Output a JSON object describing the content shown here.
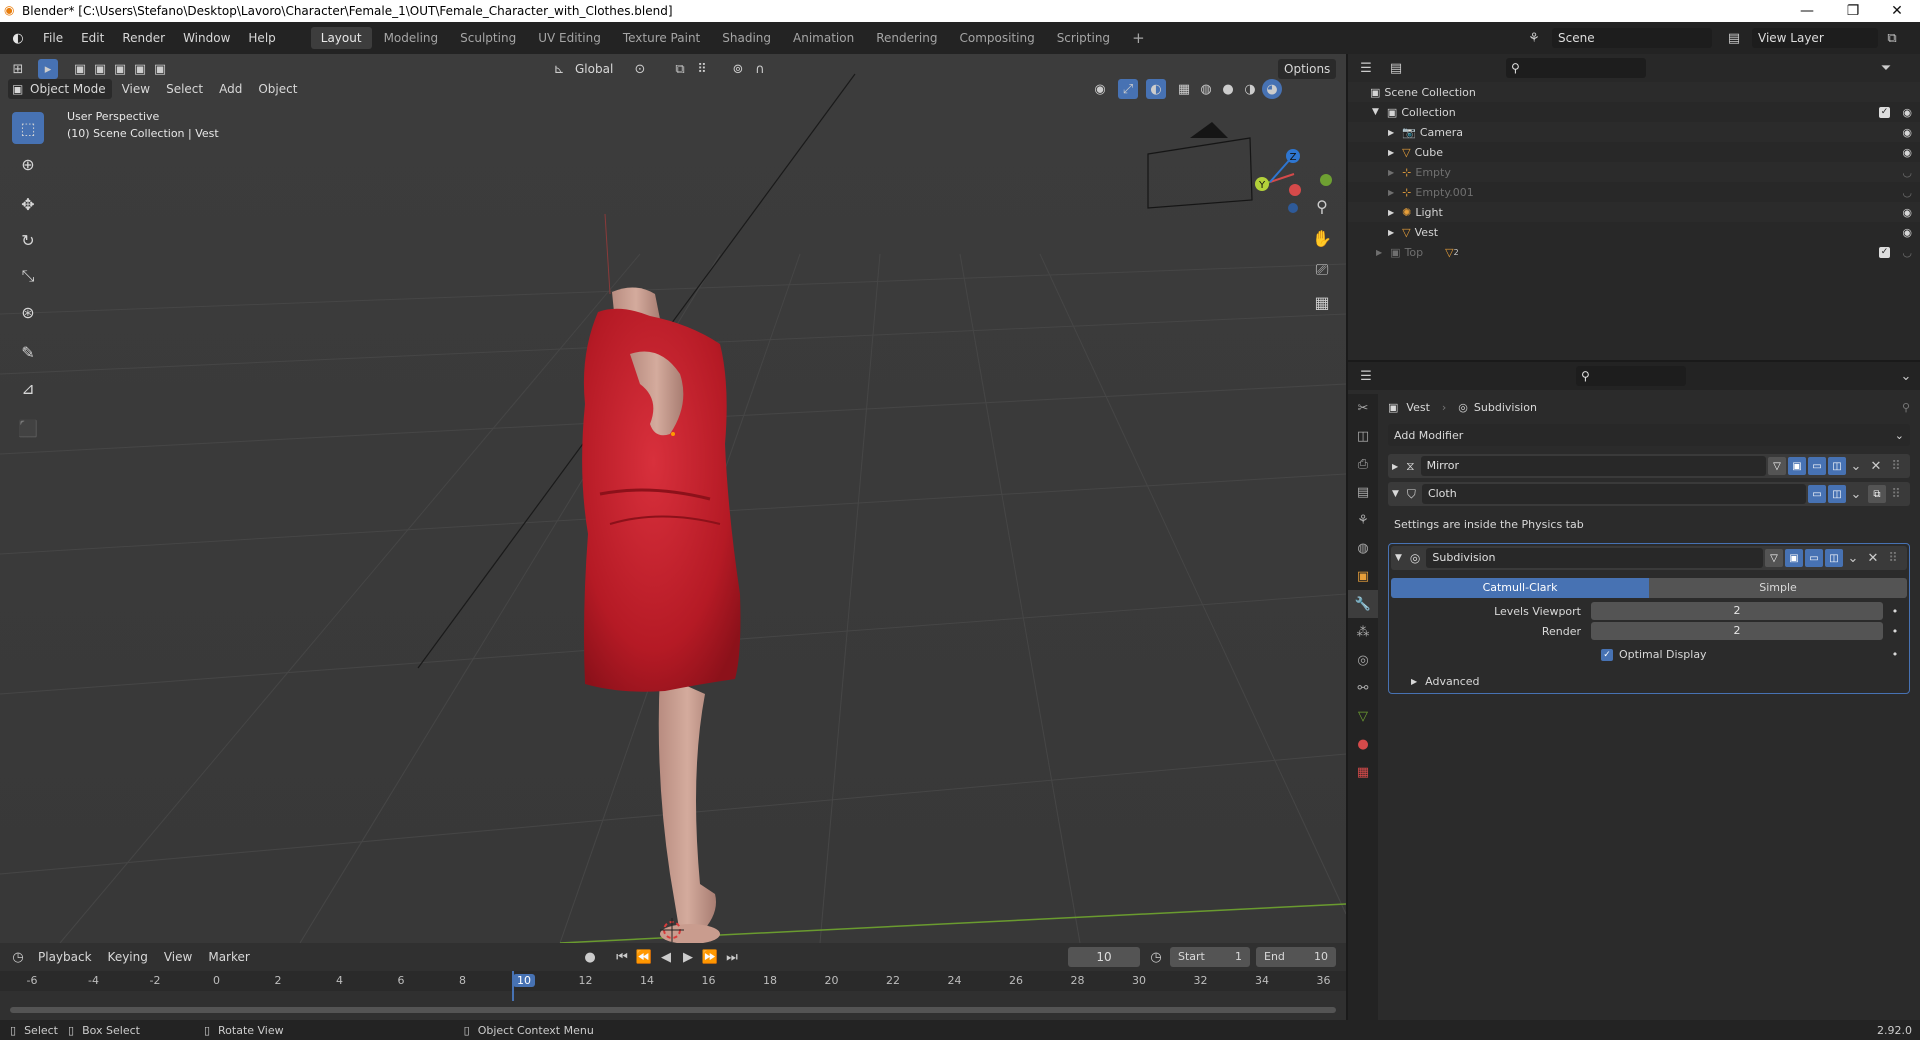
{
  "window": {
    "title": "Blender* [C:\\Users\\Stefano\\Desktop\\Lavoro\\Character\\Female_1\\OUT\\Female_Character_with_Clothes.blend]",
    "controls": {
      "minimize": "—",
      "maximize": "❐",
      "close": "✕"
    }
  },
  "menu": [
    "File",
    "Edit",
    "Render",
    "Window",
    "Help"
  ],
  "workspaces": [
    "Layout",
    "Modeling",
    "Sculpting",
    "UV Editing",
    "Texture Paint",
    "Shading",
    "Animation",
    "Rendering",
    "Compositing",
    "Scripting"
  ],
  "workspace_add": "+",
  "scene": {
    "name": "Scene",
    "view_layer": "View Layer"
  },
  "viewport": {
    "mode": "Object Mode",
    "menus": [
      "View",
      "Select",
      "Add",
      "Object"
    ],
    "orientation": "Global",
    "options": "Options",
    "overlay_title": "User Perspective",
    "overlay_sub": "(10) Scene Collection | Vest",
    "gizmo": {
      "z": "Z",
      "y": "Y",
      "x": "X"
    },
    "dress_color": "#c11b28",
    "skin_color": "#d2a596"
  },
  "outliner": {
    "root": "Scene Collection",
    "collection": "Collection",
    "items": [
      {
        "name": "Camera",
        "icon": "camera-icon",
        "dim": false
      },
      {
        "name": "Cube",
        "icon": "mesh-icon",
        "dim": false
      },
      {
        "name": "Empty",
        "icon": "empty-icon",
        "dim": true
      },
      {
        "name": "Empty.001",
        "icon": "empty-icon",
        "dim": true
      },
      {
        "name": "Light",
        "icon": "light-icon",
        "dim": false
      },
      {
        "name": "Vest",
        "icon": "mesh-icon",
        "dim": false
      }
    ],
    "other_collection": "Top",
    "other_badge": "2"
  },
  "properties": {
    "breadcrumb_object": "Vest",
    "breadcrumb_modifier": "Subdivision",
    "add_modifier": "Add Modifier",
    "modifiers": {
      "mirror": "Mirror",
      "cloth": "Cloth",
      "cloth_note": "Settings are inside the Physics tab",
      "subdivision": "Subdivision"
    },
    "subdivision": {
      "type_options": [
        "Catmull-Clark",
        "Simple"
      ],
      "levels_viewport_label": "Levels Viewport",
      "levels_viewport": "2",
      "render_label": "Render",
      "render": "2",
      "optimal_display": "Optimal Display",
      "advanced": "Advanced"
    }
  },
  "timeline": {
    "menus": [
      "Playback",
      "Keying",
      "View",
      "Marker"
    ],
    "current_frame": "10",
    "start_label": "Start",
    "start": "1",
    "end_label": "End",
    "end": "10",
    "ruler": [
      "-6",
      "-4",
      "-2",
      "0",
      "2",
      "4",
      "6",
      "8",
      "10",
      "12",
      "14",
      "16",
      "18",
      "20",
      "22",
      "24",
      "26",
      "28",
      "30",
      "32",
      "34",
      "36"
    ]
  },
  "status": {
    "select": "Select",
    "box_select": "Box Select",
    "rotate_view": "Rotate View",
    "context_menu": "Object Context Menu",
    "version": "2.92.0"
  },
  "accent": "#4772b3"
}
